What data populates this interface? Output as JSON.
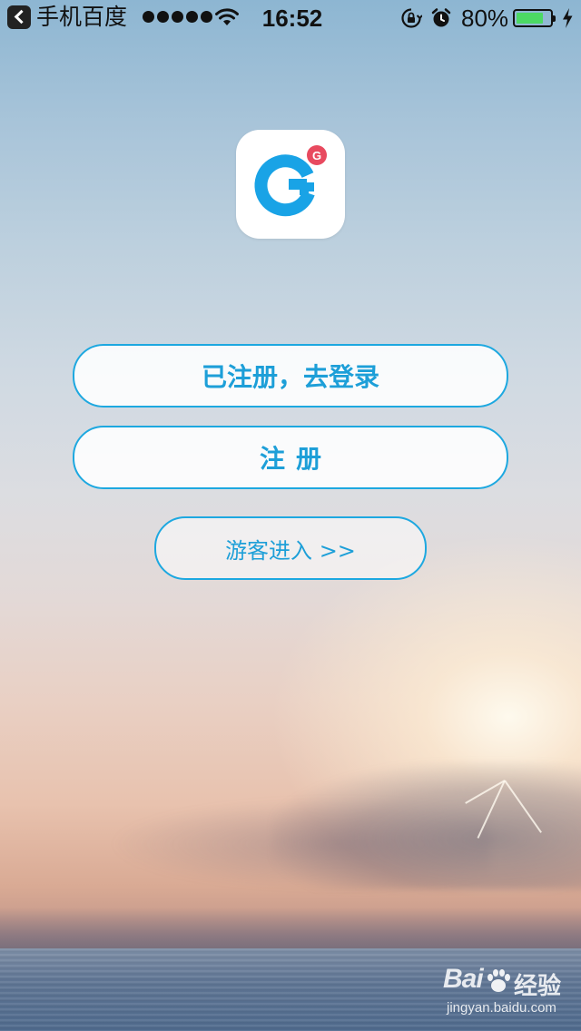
{
  "status_bar": {
    "back_app_label": "手机百度",
    "time": "16:52",
    "battery_percent": "80%",
    "battery_level": 0.8,
    "signal_bars": 5,
    "back_icon": "chevron-left-icon",
    "wifi_icon": "wifi-icon",
    "rotation_lock_icon": "rotation-lock-icon",
    "alarm_icon": "alarm-icon",
    "charging_icon": "bolt-icon",
    "battery_color": "#4cd964"
  },
  "app": {
    "logo_icon": "g-logo-icon",
    "logo_badge": "G",
    "brand_color": "#1da8e0",
    "badge_color": "#e84a5f"
  },
  "actions": {
    "login_label": "已注册，去登录",
    "register_label": "注册",
    "guest_label": "游客进入 >>"
  },
  "watermark": {
    "brand": "Bai",
    "product": "经验",
    "url": "jingyan.baidu.com"
  }
}
